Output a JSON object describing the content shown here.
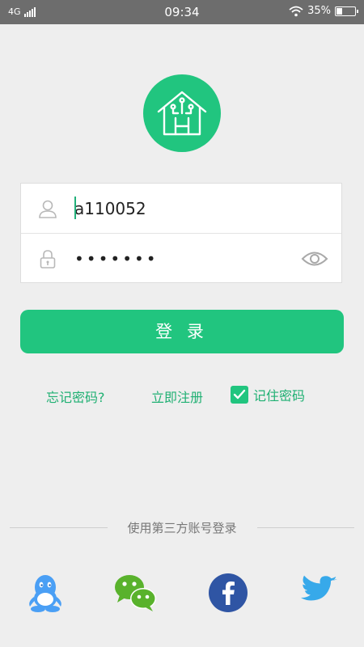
{
  "status_bar": {
    "network": "4G",
    "time": "09:34",
    "battery_percent": "35%",
    "battery_level": 0.35
  },
  "logo": {
    "icon": "smart-home-icon",
    "color": "#21c57f"
  },
  "form": {
    "username_value": "a110052",
    "password_value": "1234567"
  },
  "login_button": {
    "label": "登 录",
    "color": "#21c57f"
  },
  "links": {
    "forgot_password": "忘记密码?",
    "register": "立即注册",
    "remember_password": "记住密码",
    "remember_checked": true
  },
  "third_party": {
    "title": "使用第三方账号登录",
    "providers": [
      "qq-icon",
      "wechat-icon",
      "facebook-icon",
      "twitter-icon"
    ]
  }
}
